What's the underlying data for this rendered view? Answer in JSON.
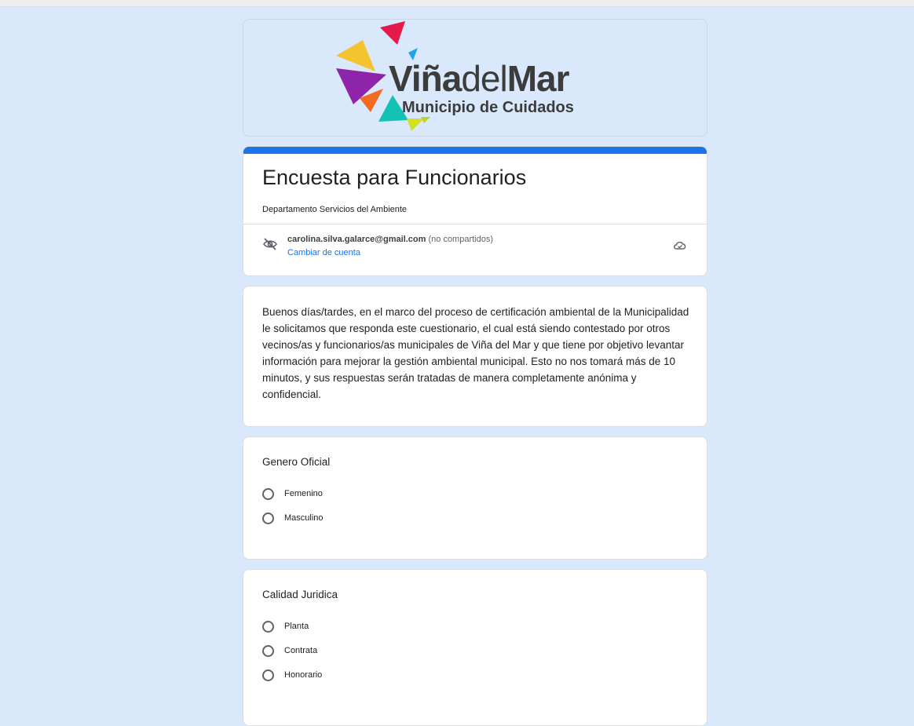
{
  "colors": {
    "page_background": "#d9e9fb",
    "accent": "#1a73e8",
    "link": "#1a73e8",
    "text": "#202124",
    "logo_text": "#3c3c3c"
  },
  "banner": {
    "brand_name_bold_1": "Viña",
    "brand_name_light": "del",
    "brand_name_bold_2": "Mar",
    "tagline": "Municipio de Cuidados"
  },
  "form": {
    "title": "Encuesta para Funcionarios",
    "description": "Departamento Servicios del Ambiente"
  },
  "account": {
    "email": "carolina.silva.galarce@gmail.com",
    "sharing_note": "(no compartidos)",
    "switch_account": "Cambiar de cuenta",
    "eye_icon": "eye-off-icon",
    "cloud_icon": "cloud-done-icon"
  },
  "intro": {
    "text": "Buenos días/tardes, en el marco del proceso de certificación ambiental de la Municipalidad le solicitamos que responda este cuestionario, el cual está siendo contestado por otros vecinos/as y funcionarios/as municipales de Viña del Mar y que tiene por objetivo levantar información para mejorar la gestión ambiental municipal. Esto no nos tomará más de 10 minutos, y sus respuestas serán tratadas de manera completamente anónima y confidencial."
  },
  "questions": [
    {
      "title": "Genero Oficial",
      "options": [
        "Femenino",
        "Masculino"
      ]
    },
    {
      "title": "Calidad Juridica",
      "options": [
        "Planta",
        "Contrata",
        "Honorario"
      ]
    }
  ]
}
